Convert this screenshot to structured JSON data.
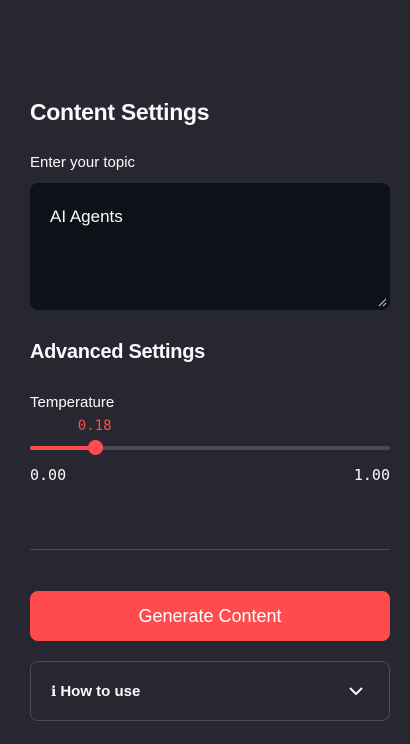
{
  "content_settings": {
    "heading": "Content Settings",
    "topic_label": "Enter your topic",
    "topic_value": "AI Agents"
  },
  "advanced_settings": {
    "heading": "Advanced Settings",
    "temperature": {
      "label": "Temperature",
      "value": 0.18,
      "value_text": "0.18",
      "min": 0.0,
      "max": 1.0,
      "min_text": "0.00",
      "max_text": "1.00"
    }
  },
  "actions": {
    "generate_label": "Generate Content"
  },
  "help": {
    "icon": "ℹ",
    "title": "How to use"
  },
  "theme": {
    "accent": "#ff4b4b",
    "background": "#262730",
    "input_background": "#0e1117",
    "text": "#fafafa"
  }
}
